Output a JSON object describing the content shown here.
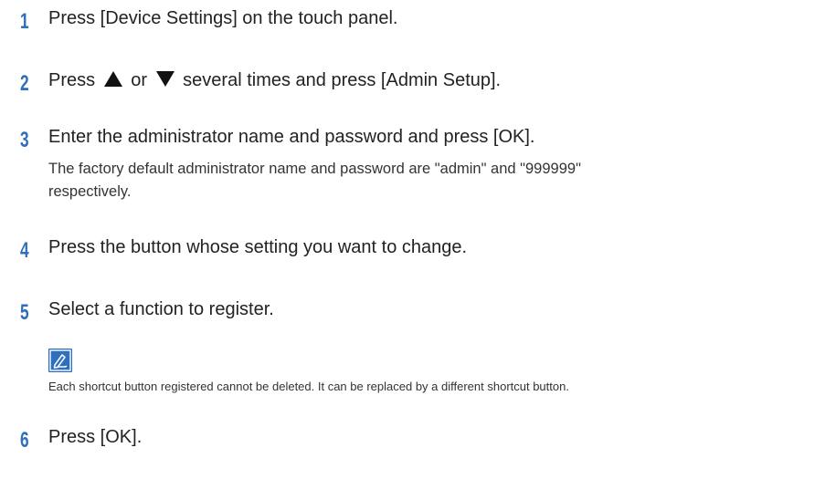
{
  "steps": [
    {
      "number": "1",
      "text": "Press [Device Settings] on the touch panel."
    },
    {
      "number": "2",
      "text_before": "Press",
      "text_middle": "or",
      "text_after": "several times and press [Admin Setup].",
      "up_icon": "up-triangle-icon",
      "down_icon": "down-triangle-icon"
    },
    {
      "number": "3",
      "text": "Enter the administrator name and password and press [OK].",
      "note_line1": "The factory default administrator name and password are \"admin\" and \"999999\"",
      "note_line2": "respectively."
    },
    {
      "number": "4",
      "text": "Press the button whose setting you want to change."
    },
    {
      "number": "5",
      "text": "Select a function to register."
    },
    {
      "number": "6",
      "text": "Press [OK]."
    }
  ],
  "memo": {
    "icon": "pencil-memo-icon",
    "text": "Each shortcut button registered cannot be deleted. It can be replaced by a different shortcut button."
  },
  "colors": {
    "step_number": "#2d6fb8",
    "memo_icon_bg": "#2e6fc0",
    "body_text": "#222222"
  }
}
